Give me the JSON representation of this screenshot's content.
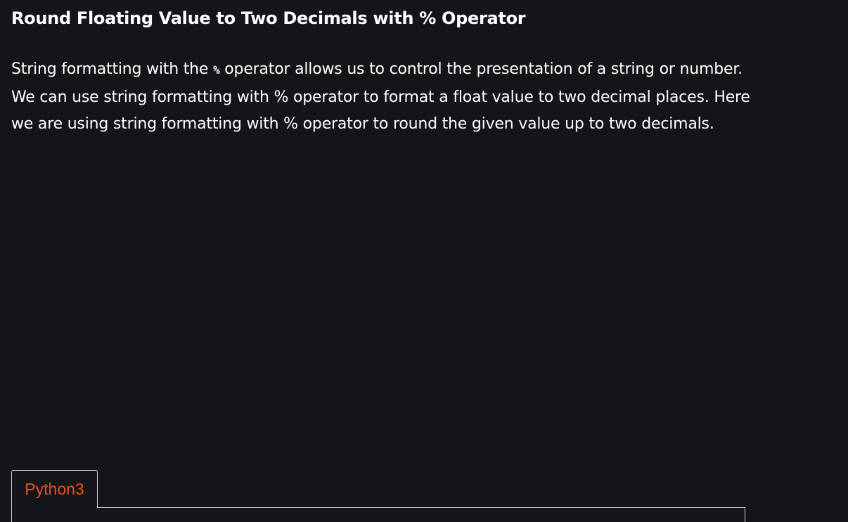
{
  "article": {
    "heading": "Round Floating Value to Two Decimals with % Operator",
    "paragraph": {
      "part1": "String formatting with the ",
      "inline_code": "%",
      "part2": " operator allows us to control the presentation of a string or number. We can use string formatting with % operator to format a float value to two decimal places. Here we are using string formatting with % operator  to round the given value up to two decimals."
    }
  },
  "code_tabs": {
    "items": [
      {
        "label": "Python3",
        "active": true
      }
    ]
  },
  "colors": {
    "background": "#141519",
    "text": "#ffffff",
    "tab_label": "#e9531f",
    "border": "#d3d3d3"
  }
}
